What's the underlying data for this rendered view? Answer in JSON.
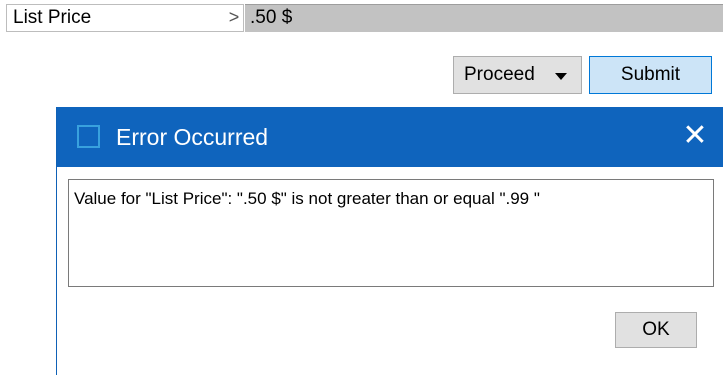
{
  "field": {
    "label": "List Price",
    "arrow": ">",
    "value": ".50 $"
  },
  "buttons": {
    "proceed_label": "Proceed",
    "submit_label": "Submit"
  },
  "dialog": {
    "title": "Error Occurred",
    "close_glyph": "✕",
    "message": "Value for \"List Price\": \".50 $\" is not greater than or equal \".99 \"",
    "ok_label": "OK"
  },
  "colors": {
    "titlebar": "#0f64bd",
    "submit_bg": "#cce4f7",
    "field_value_bg": "#c2c2c2"
  }
}
